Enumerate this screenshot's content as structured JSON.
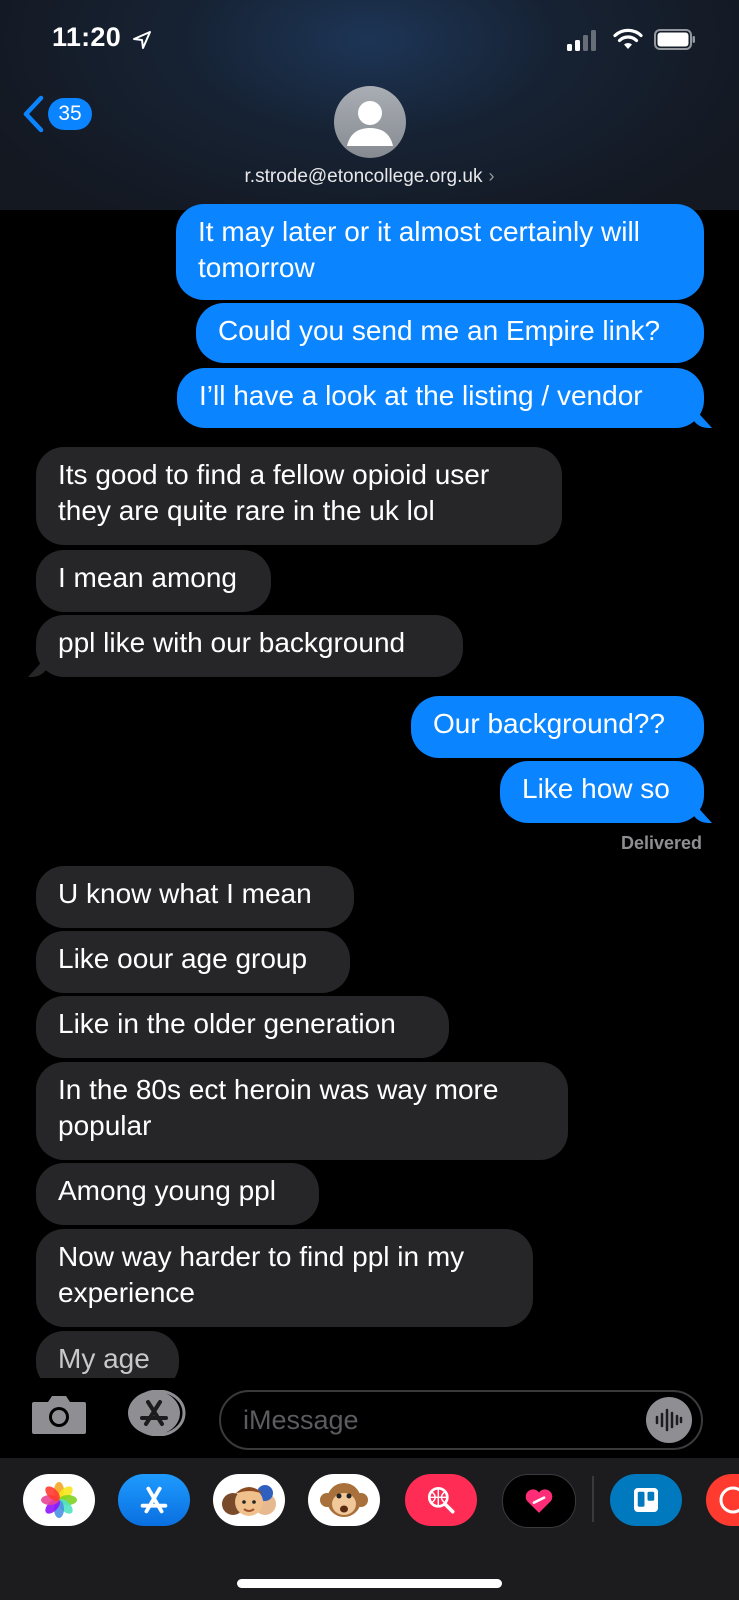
{
  "status_bar": {
    "time": "11:20"
  },
  "header": {
    "back_count": "35",
    "contact": "r.strode@etoncollege.org.uk",
    "contact_chevron": "›"
  },
  "messages": [
    {
      "dir": "out",
      "text": "It may later or it almost certainly will\ntomorrow"
    },
    {
      "dir": "out",
      "text": "Could you send me an Empire link?"
    },
    {
      "dir": "out",
      "text": "I’ll have a look at the listing / vendor"
    },
    {
      "dir": "in",
      "text": "Its good to find a fellow opioid user\nthey are quite rare in the uk lol"
    },
    {
      "dir": "in",
      "text": "I mean among"
    },
    {
      "dir": "in",
      "text": "ppl like with our background"
    },
    {
      "dir": "out",
      "text": "Our background??"
    },
    {
      "dir": "out",
      "text": "Like how so"
    },
    {
      "dir": "in",
      "text": "U know what I mean"
    },
    {
      "dir": "in",
      "text": "Like oour age group"
    },
    {
      "dir": "in",
      "text": "Like in the older generation"
    },
    {
      "dir": "in",
      "text": "In the 80s ect heroin was way more\npopular"
    },
    {
      "dir": "in",
      "text": "Among young ppl"
    },
    {
      "dir": "in",
      "text": "Now way harder to find ppl in my\nexperience"
    },
    {
      "dir": "in",
      "text": "My age"
    }
  ],
  "delivered_label": "Delivered",
  "composer": {
    "placeholder": "iMessage"
  },
  "icons": {
    "camera": "camera-icon",
    "apps": "app-store-icon",
    "audio": "audio-waveform-icon",
    "tray": [
      "photos-icon",
      "app-store-icon",
      "memoji-icon",
      "animoji-icon",
      "web-search-icon",
      "digital-touch-icon",
      "trello-icon",
      "partial-app-icon"
    ]
  },
  "colors": {
    "outgoing": "#0a84ff",
    "incoming": "#262628",
    "background": "#000000"
  }
}
